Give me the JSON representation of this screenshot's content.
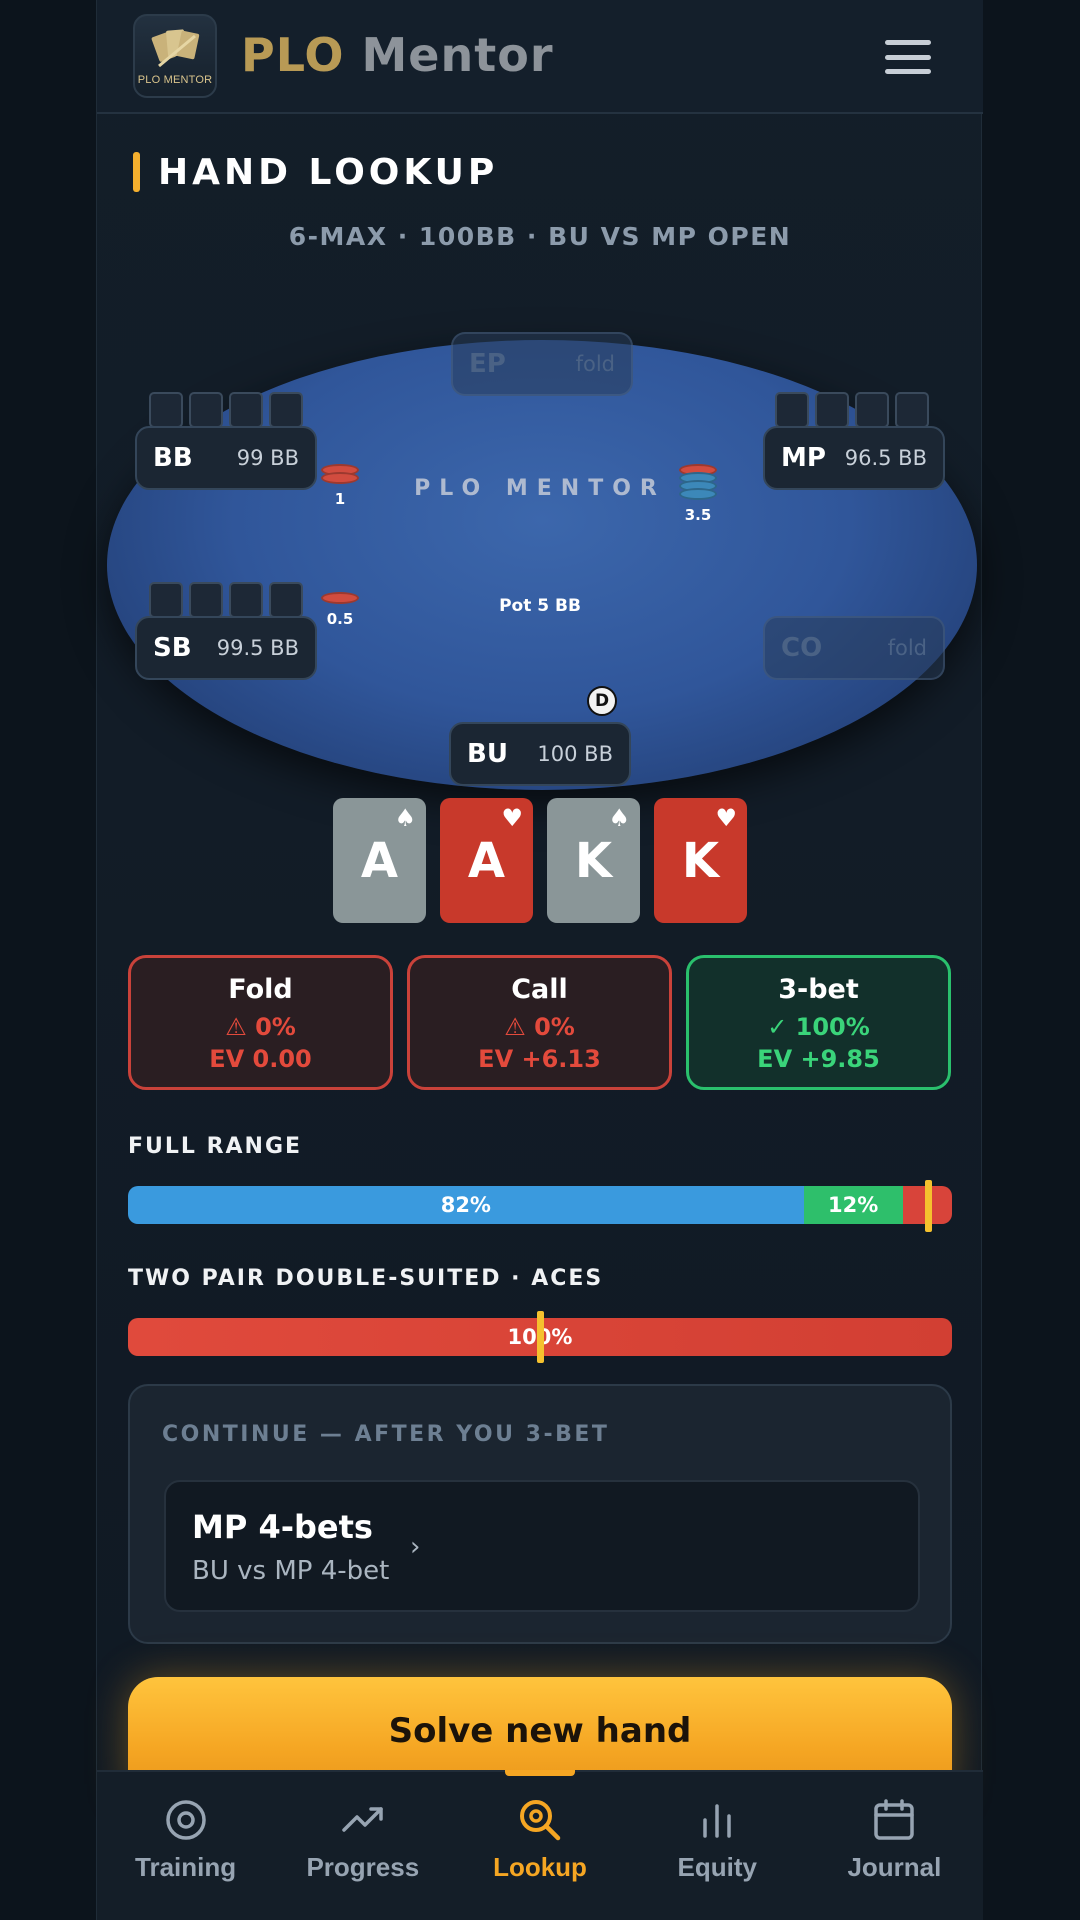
{
  "header": {
    "logo_caption": "PLO MENTOR",
    "brand_part1": "PLO",
    "brand_part2": "Mentor"
  },
  "section_title": "HAND LOOKUP",
  "scenario": "6-MAX · 100BB · BU VS MP OPEN",
  "table": {
    "felt_label": "PLO MENTOR",
    "pot": "Pot 5 BB",
    "dealer": "D",
    "seats": [
      {
        "pos": "EP",
        "stack": "fold",
        "folded": true
      },
      {
        "pos": "BB",
        "stack": "99 BB",
        "folded": false
      },
      {
        "pos": "MP",
        "stack": "96.5 BB",
        "folded": false
      },
      {
        "pos": "SB",
        "stack": "99.5 BB",
        "folded": false
      },
      {
        "pos": "CO",
        "stack": "fold",
        "folded": true
      },
      {
        "pos": "BU",
        "stack": "100 BB",
        "folded": false
      }
    ],
    "bets": {
      "bb": "1",
      "mp": "3.5",
      "sb": "0.5"
    }
  },
  "hand": [
    {
      "rank": "A",
      "suit": "spade",
      "color": "grey"
    },
    {
      "rank": "A",
      "suit": "heart",
      "color": "red"
    },
    {
      "rank": "K",
      "suit": "spade",
      "color": "grey"
    },
    {
      "rank": "K",
      "suit": "heart",
      "color": "red"
    }
  ],
  "actions": [
    {
      "name": "Fold",
      "freq": "0%",
      "ev": "EV 0.00",
      "status": "warning"
    },
    {
      "name": "Call",
      "freq": "0%",
      "ev": "EV +6.13",
      "status": "warning"
    },
    {
      "name": "3-bet",
      "freq": "100%",
      "ev": "EV +9.85",
      "status": "best"
    }
  ],
  "full_range": {
    "label": "FULL RANGE",
    "segments": [
      {
        "label": "82%",
        "value": 82,
        "color": "#3a9ade"
      },
      {
        "label": "12%",
        "value": 12,
        "color": "#2ebf6b"
      },
      {
        "label": "",
        "value": 6,
        "color": "#d8443a"
      }
    ]
  },
  "hand_class": {
    "label": "TWO PAIR DOUBLE-SUITED · ACES",
    "segments": [
      {
        "label": "100%",
        "value": 100,
        "color": "#e04a3c"
      }
    ]
  },
  "continue": {
    "heading": "CONTINUE — AFTER YOU 3-BET",
    "item_title": "MP 4-bets",
    "item_subtitle": "BU vs MP 4-bet",
    "chevron": "›"
  },
  "cta": "Solve new hand",
  "nav": [
    {
      "label": "Training",
      "icon": "target-icon",
      "active": false
    },
    {
      "label": "Progress",
      "icon": "trend-up-icon",
      "active": false
    },
    {
      "label": "Lookup",
      "icon": "search-icon",
      "active": true
    },
    {
      "label": "Equity",
      "icon": "bar-chart-icon",
      "active": false
    },
    {
      "label": "Journal",
      "icon": "calendar-icon",
      "active": false
    }
  ],
  "colors": {
    "accent": "#f5a623",
    "bad": "#e34a3c",
    "good": "#3ad47a",
    "felt": "#30569a"
  }
}
